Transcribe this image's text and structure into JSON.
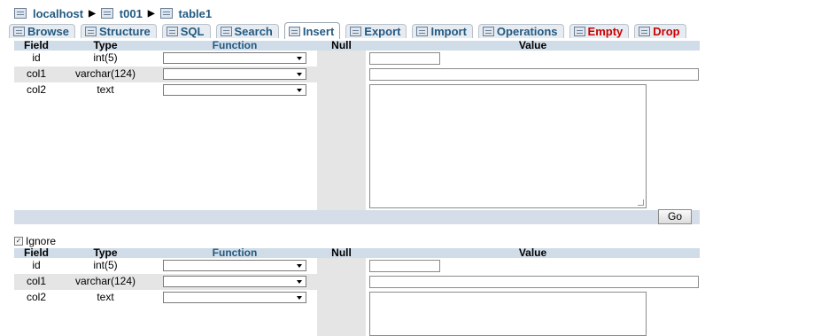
{
  "breadcrumb": {
    "server": "localhost",
    "database": "t001",
    "table": "table1"
  },
  "tabs": [
    {
      "label": "Browse"
    },
    {
      "label": "Structure"
    },
    {
      "label": "SQL"
    },
    {
      "label": "Search"
    },
    {
      "label": "Insert",
      "active": true
    },
    {
      "label": "Export"
    },
    {
      "label": "Import"
    },
    {
      "label": "Operations"
    },
    {
      "label": "Empty",
      "danger": true
    },
    {
      "label": "Drop",
      "danger": true
    }
  ],
  "headers": {
    "field": "Field",
    "type": "Type",
    "function": "Function",
    "null": "Null",
    "value": "Value"
  },
  "rows": [
    {
      "field": "id",
      "type": "int(5)"
    },
    {
      "field": "col1",
      "type": "varchar(124)"
    },
    {
      "field": "col2",
      "type": "text"
    }
  ],
  "go_label": "Go",
  "ignore_label": "Ignore",
  "ignore_checked": true
}
